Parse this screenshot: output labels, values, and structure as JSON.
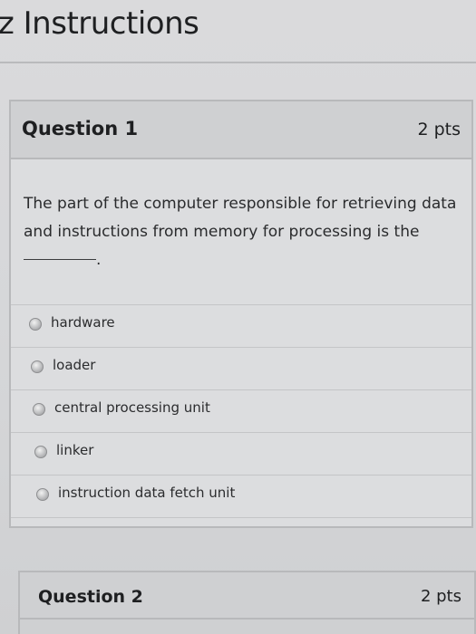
{
  "page": {
    "title": "z Instructions"
  },
  "question1": {
    "label": "Question 1",
    "points": "2 pts",
    "text_before_blank": "The part of the computer responsible for retrieving data and instructions from memory for processing is the",
    "text_after_blank": ".",
    "answers": [
      {
        "label": "hardware",
        "selected": false
      },
      {
        "label": "loader",
        "selected": false
      },
      {
        "label": "central processing unit",
        "selected": false
      },
      {
        "label": "linker",
        "selected": false
      },
      {
        "label": "instruction data fetch unit",
        "selected": false
      }
    ]
  },
  "question2": {
    "label": "Question 2",
    "points": "2 pts"
  }
}
